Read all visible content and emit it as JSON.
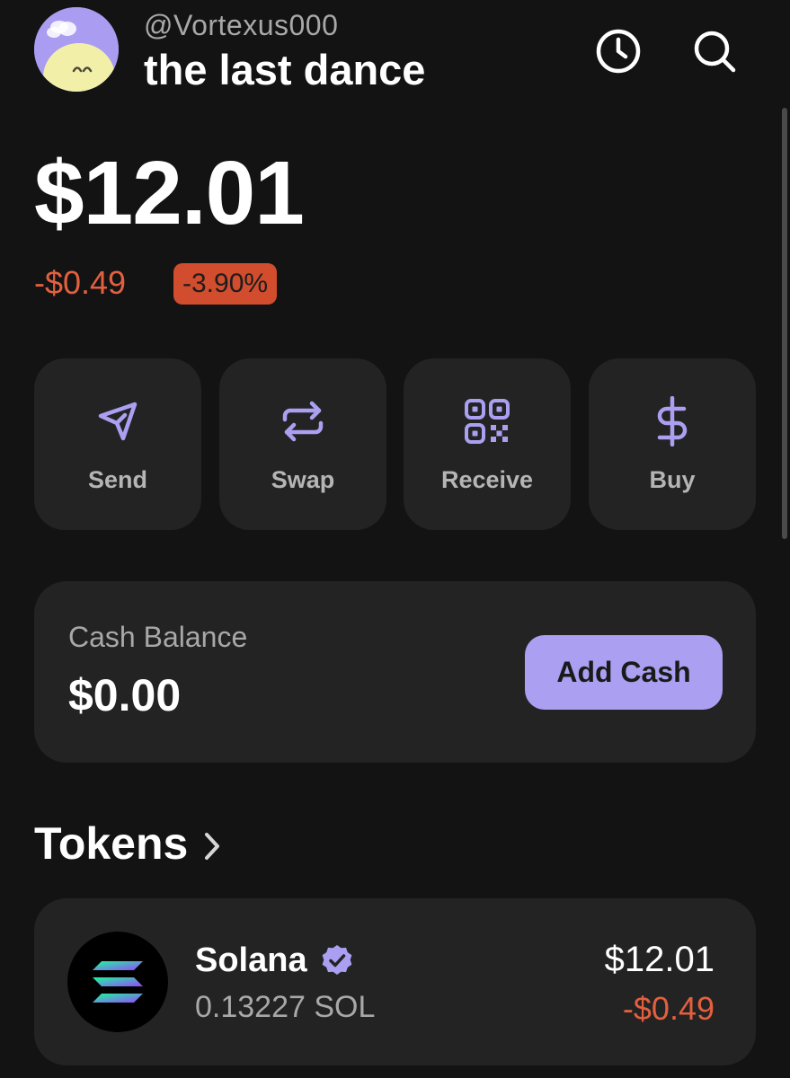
{
  "header": {
    "handle": "@Vortexus000",
    "wallet_name": "the last dance",
    "icons": [
      "clock-icon",
      "search-icon"
    ]
  },
  "balance": {
    "total": "$12.01",
    "change_abs": "-$0.49",
    "change_pct": "-3.90%"
  },
  "actions": [
    {
      "label": "Send",
      "icon": "send-icon"
    },
    {
      "label": "Swap",
      "icon": "swap-icon"
    },
    {
      "label": "Receive",
      "icon": "qr-code-icon"
    },
    {
      "label": "Buy",
      "icon": "dollar-icon"
    }
  ],
  "cash": {
    "label": "Cash Balance",
    "value": "$0.00",
    "button": "Add Cash"
  },
  "tokens": {
    "title": "Tokens",
    "items": [
      {
        "name": "Solana",
        "amount": "0.13227 SOL",
        "value": "$12.01",
        "change": "-$0.49",
        "verified": true
      }
    ]
  },
  "colors": {
    "background": "#131313",
    "card": "#232323",
    "accent": "#ab9ff2",
    "negative": "#e2603f",
    "muted": "#a8a8a8"
  }
}
